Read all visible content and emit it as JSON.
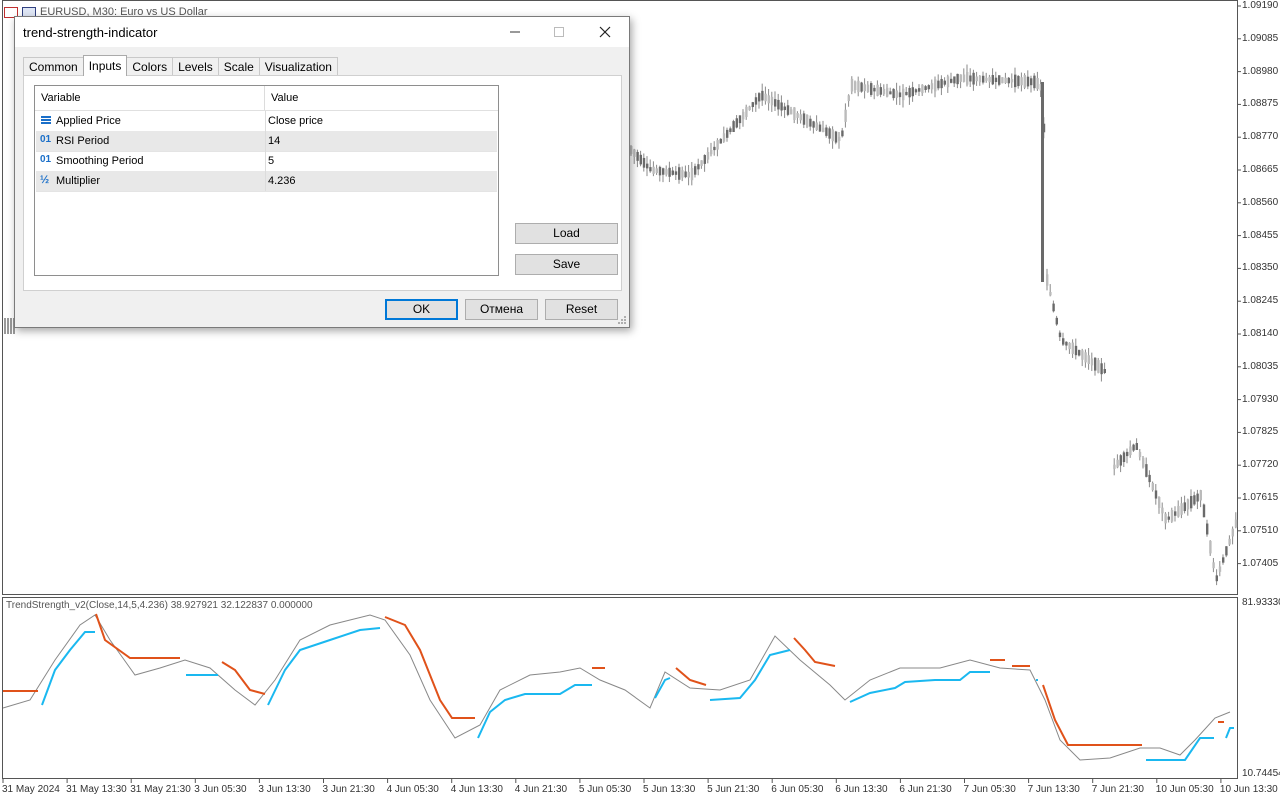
{
  "chart": {
    "symbol_label": "EURUSD, M30:  Euro vs US Dollar",
    "price_labels": [
      "1.09190",
      "1.09085",
      "1.08980",
      "1.08875",
      "1.08770",
      "1.08665",
      "1.08560",
      "1.08455",
      "1.08350",
      "1.08245",
      "1.08140",
      "1.08035",
      "1.07930",
      "1.07825",
      "1.07720",
      "1.07615",
      "1.07510",
      "1.07405"
    ],
    "time_labels": [
      "31 May 2024",
      "31 May 13:30",
      "31 May 21:30",
      "3 Jun 05:30",
      "3 Jun 13:30",
      "3 Jun 21:30",
      "4 Jun 05:30",
      "4 Jun 13:30",
      "4 Jun 21:30",
      "5 Jun 05:30",
      "5 Jun 13:30",
      "5 Jun 21:30",
      "6 Jun 05:30",
      "6 Jun 13:30",
      "6 Jun 21:30",
      "7 Jun 05:30",
      "7 Jun 13:30",
      "7 Jun 21:30",
      "10 Jun 05:30",
      "10 Jun 13:30"
    ],
    "indicator_title": "TrendStrength_v2(Close,14,5,4.236) 38.927921 32.122837 0.000000",
    "subwindow_max": "81.93330",
    "subwindow_min": "10.74454",
    "colors": {
      "bull_line": "#1ab8f0",
      "bear_line": "#e0521a",
      "osc_line": "#888888",
      "candle": "#8a8a8a"
    }
  },
  "dialog": {
    "title": "trend-strength-indicator",
    "tabs": [
      "Common",
      "Inputs",
      "Colors",
      "Levels",
      "Scale",
      "Visualization"
    ],
    "active_tab": "Inputs",
    "table": {
      "headers": {
        "variable": "Variable",
        "value": "Value"
      },
      "rows": [
        {
          "icon": "list-icon",
          "variable": "Applied Price",
          "value": "Close price"
        },
        {
          "icon": "integer-icon",
          "variable": "RSI Period",
          "value": "14"
        },
        {
          "icon": "integer-icon",
          "variable": "Smoothing Period",
          "value": "5"
        },
        {
          "icon": "fraction-icon",
          "variable": "Multiplier",
          "value": "4.236"
        }
      ]
    },
    "buttons": {
      "load": "Load",
      "save": "Save",
      "ok": "OK",
      "cancel": "Отмена",
      "reset": "Reset"
    }
  }
}
